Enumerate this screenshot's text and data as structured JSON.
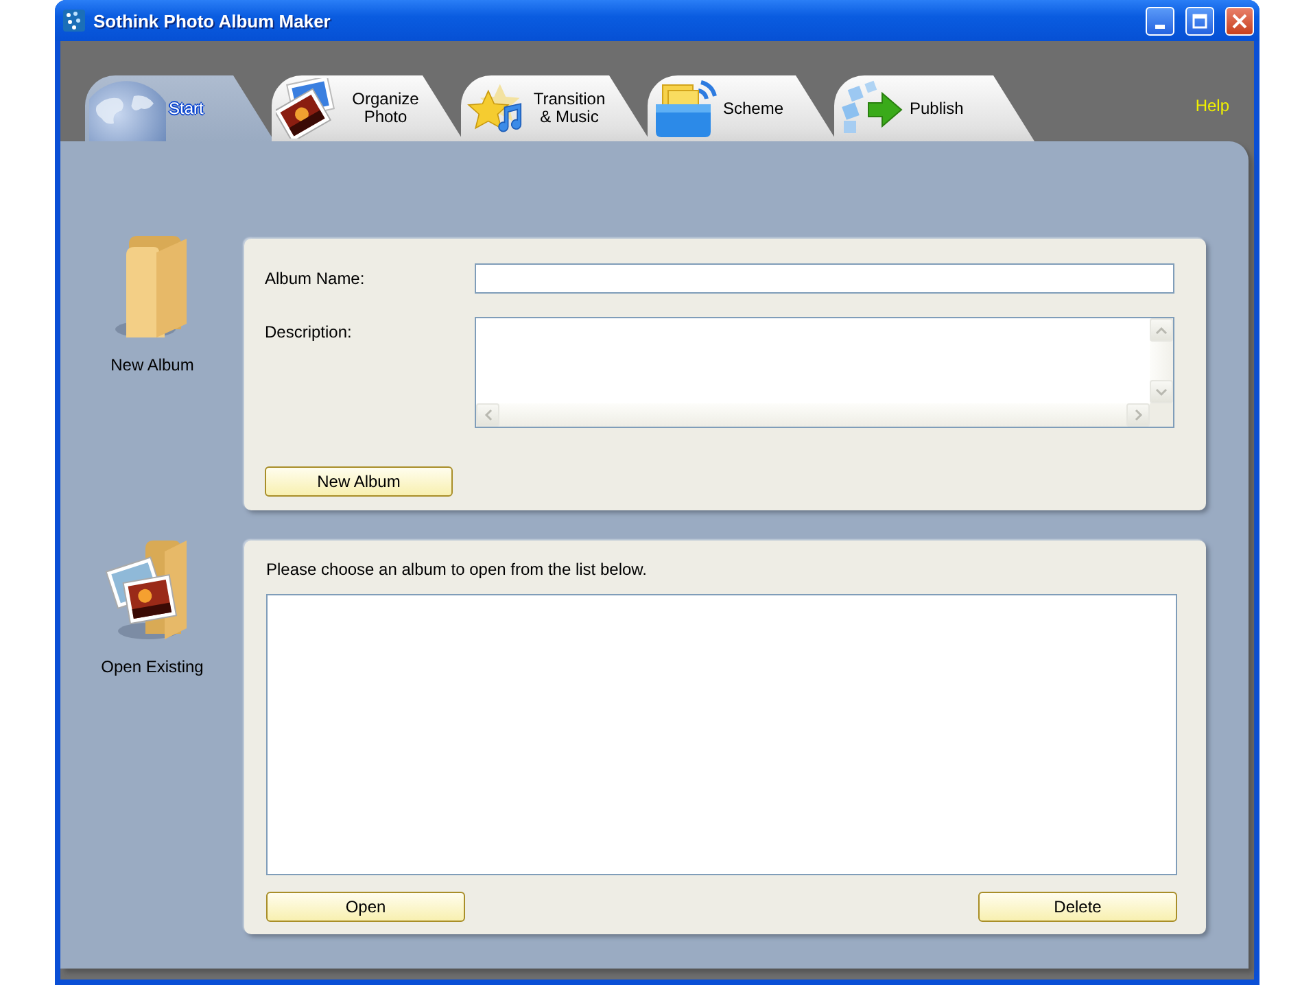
{
  "window": {
    "title": "Sothink Photo Album Maker"
  },
  "tabs": [
    {
      "label": "Start",
      "selected": true
    },
    {
      "label": "Organize Photo",
      "selected": false
    },
    {
      "label": "Transition & Music",
      "selected": false
    },
    {
      "label": "Scheme",
      "selected": false
    },
    {
      "label": "Publish",
      "selected": false
    }
  ],
  "help_link": "Help",
  "new_album": {
    "caption": "New Album",
    "album_name_label": "Album Name:",
    "description_label": "Description:",
    "button": "New Album"
  },
  "open_existing": {
    "caption": "Open Existing",
    "instruction": "Please choose an album to open from the list below.",
    "buttons": [
      "Open",
      "Delete"
    ]
  }
}
